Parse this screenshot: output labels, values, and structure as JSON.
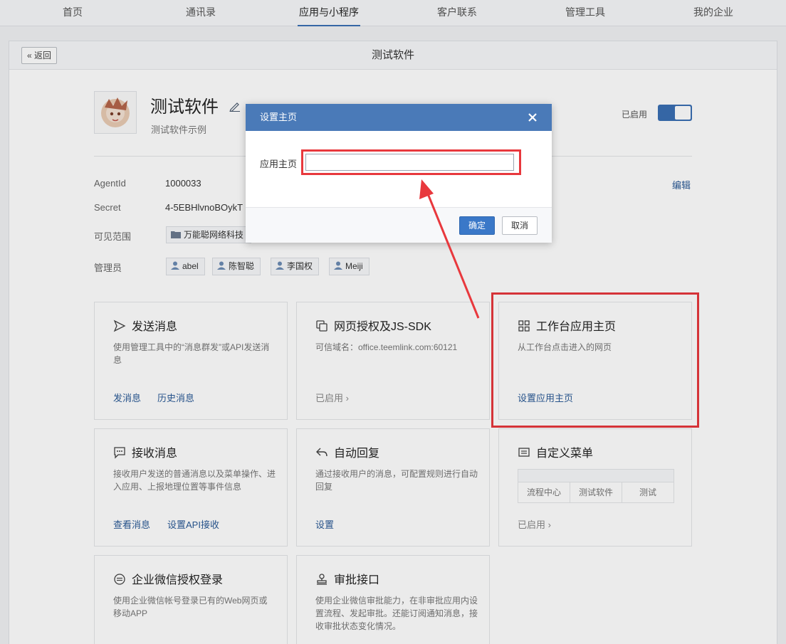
{
  "nav": [
    {
      "label": "首页"
    },
    {
      "label": "通讯录"
    },
    {
      "label": "应用与小程序"
    },
    {
      "label": "客户联系"
    },
    {
      "label": "管理工具"
    },
    {
      "label": "我的企业"
    }
  ],
  "panel": {
    "back_label": "返回",
    "title": "测试软件"
  },
  "app": {
    "name": "测试软件",
    "desc": "测试软件示例",
    "enabled_label": "已启用",
    "edit_link": "编辑"
  },
  "info": {
    "agentid_label": "AgentId",
    "agentid_value": "1000033",
    "secret_label": "Secret",
    "secret_value": "4-5EBHlvnoBOykT",
    "scope_label": "可见范围",
    "scope_value": "万能聪网络科技",
    "admin_label": "管理员",
    "admins": [
      "abel",
      "陈智聪",
      "李国权",
      "Meiji"
    ]
  },
  "cards": {
    "send": {
      "title": "发送消息",
      "desc": "使用管理工具中的“消息群发”或API发送消息",
      "link1": "发消息",
      "link2": "历史消息"
    },
    "web": {
      "title": "网页授权及JS-SDK",
      "desc": "可信域名：office.teemlink.com:60121",
      "status": "已启用"
    },
    "workbench": {
      "title": "工作台应用主页",
      "desc": "从工作台点击进入的网页",
      "link1": "设置应用主页"
    },
    "receive": {
      "title": "接收消息",
      "desc": "接收用户发送的普通消息以及菜单操作、进入应用、上报地理位置等事件信息",
      "link1": "查看消息",
      "link2": "设置API接收"
    },
    "autoreply": {
      "title": "自动回复",
      "desc": "通过接收用户的消息，可配置规则进行自动回复",
      "link1": "设置"
    },
    "menu": {
      "title": "自定义菜单",
      "items": [
        "流程中心",
        "测试软件",
        "测试"
      ],
      "status": "已启用"
    },
    "login": {
      "title": "企业微信授权登录",
      "desc": "使用企业微信帐号登录已有的Web网页或移动APP"
    },
    "approval": {
      "title": "审批接口",
      "desc": "使用企业微信审批能力，在非审批应用内设置流程、发起审批。还能订阅通知消息，接收审批状态变化情况。"
    }
  },
  "modal": {
    "title": "设置主页",
    "field_label": "应用主页",
    "field_value": "",
    "ok_label": "确定",
    "cancel_label": "取消"
  },
  "colors": {
    "accent": "#3a6fb3",
    "link": "#2a5a96",
    "highlight": "#e8383d",
    "modal_header": "#4a7ab8"
  }
}
